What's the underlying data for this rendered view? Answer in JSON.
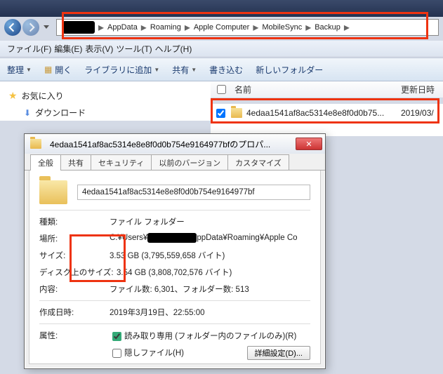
{
  "breadcrumb": {
    "items": [
      "AppData",
      "Roaming",
      "Apple Computer",
      "MobileSync",
      "Backup"
    ]
  },
  "menubar": {
    "file": "ファイル(F)",
    "edit": "編集(E)",
    "view": "表示(V)",
    "tools": "ツール(T)",
    "help": "ヘルプ(H)"
  },
  "toolbar": {
    "organize": "整理",
    "open": "開く",
    "addlib": "ライブラリに追加",
    "share": "共有",
    "burn": "書き込む",
    "newfolder": "新しいフォルダー"
  },
  "cols": {
    "name": "名前",
    "date": "更新日時"
  },
  "tree": {
    "favorites": "お気に入り",
    "downloads": "ダウンロード"
  },
  "file": {
    "name": "4edaa1541af8ac5314e8e8f0d0b75...",
    "date": "2019/03/"
  },
  "dialog": {
    "title": "4edaa1541af8ac5314e8e8f0d0b754e9164977bfのプロパ...",
    "tabs": {
      "general": "全般",
      "share": "共有",
      "security": "セキュリティ",
      "prev": "以前のバージョン",
      "custom": "カスタマイズ"
    },
    "name": "4edaa1541af8ac5314e8e8f0d0b754e9164977bf",
    "rows": {
      "type_l": "種類:",
      "type_v": "ファイル フォルダー",
      "loc_l": "場所:",
      "loc_v_a": "C:¥Users¥",
      "loc_v_b": "ppData¥Roaming¥Apple Co",
      "size_l": "サイズ:",
      "size_v": "3.53 GB (3,795,559,658 バイト)",
      "disk_l": "ディスク上のサイズ:",
      "disk_v": "3.54 GB (3,808,702,576 バイト)",
      "cont_l": "内容:",
      "cont_v": "ファイル数: 6,301、フォルダー数: 513",
      "created_l": "作成日時:",
      "created_v": "2019年3月19日、22:55:00",
      "attr_l": "属性:",
      "readonly": "読み取り専用 (フォルダー内のファイルのみ)(R)",
      "hidden": "隠しファイル(H)",
      "details": "詳細設定(D)..."
    }
  }
}
